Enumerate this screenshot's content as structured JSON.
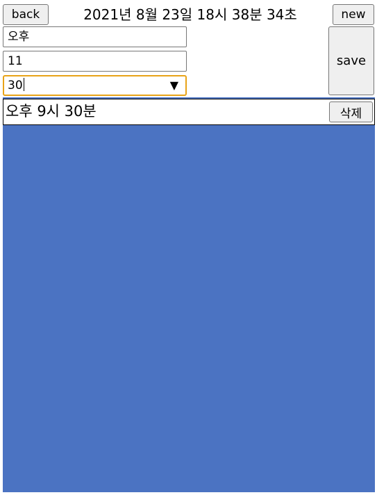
{
  "header": {
    "back_label": "back",
    "datetime": "2021년 8월 23일 18시 38분 34초",
    "new_label": "new"
  },
  "form": {
    "ampm_value": "오후",
    "hour_value": "11",
    "minute_value": "30",
    "save_label": "save"
  },
  "alarms": [
    {
      "time_text": "오후 9시 30분",
      "delete_label": "삭제"
    }
  ],
  "colors": {
    "list_background": "#4b73c2",
    "focus_outline": "#e8a317"
  }
}
